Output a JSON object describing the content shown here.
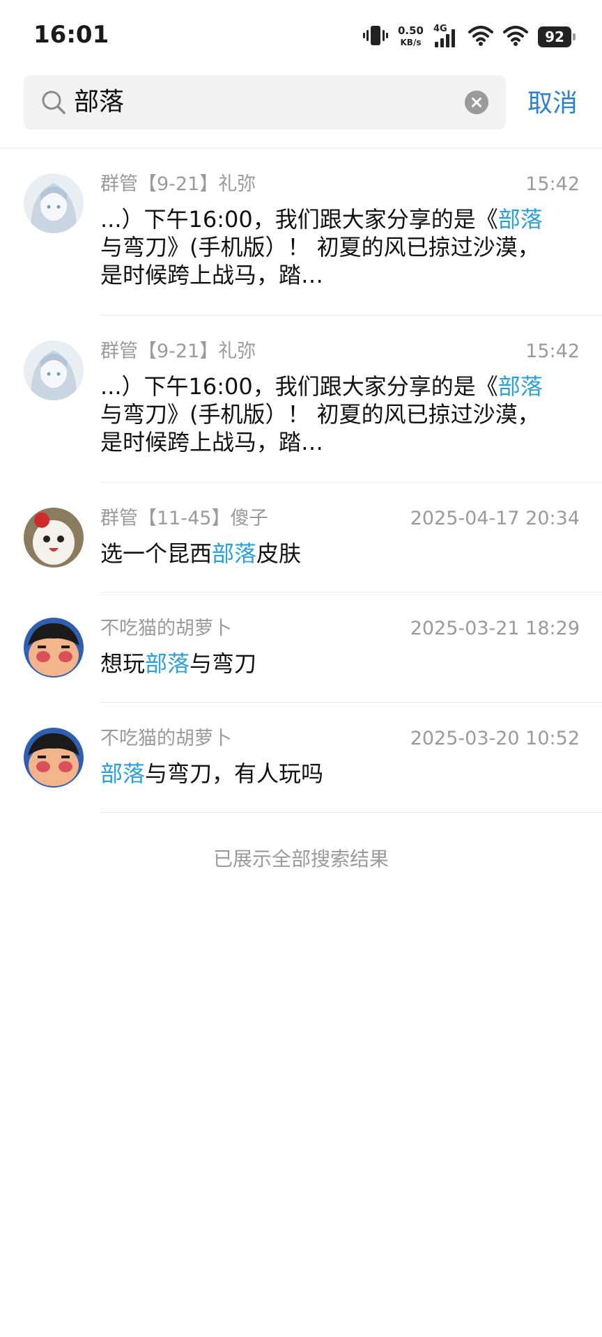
{
  "status_bar": {
    "time": "16:01",
    "net_speed": "0.50",
    "net_unit": "KB/s",
    "network_type": "4G",
    "battery": "92",
    "icons": [
      "vibrate-icon",
      "signal-icon",
      "wifi-icon",
      "wifi-icon",
      "battery-icon"
    ]
  },
  "search": {
    "query": "部落",
    "cancel_label": "取消"
  },
  "results": [
    {
      "sender": "群管【9-21】礼弥",
      "time": "15:42",
      "lines": [
        [
          {
            "t": "...）下午16:00，我们跟大家分享的是《"
          },
          {
            "t": "部落",
            "hl": true
          }
        ],
        [
          {
            "t": "与弯刀》(手机版）！ 初夏的风已掠过沙漠，"
          }
        ],
        [
          {
            "t": "是时候跨上战马，踏…"
          }
        ]
      ]
    },
    {
      "sender": "群管【9-21】礼弥",
      "time": "15:42",
      "lines": [
        [
          {
            "t": "...）下午16:00，我们跟大家分享的是《"
          },
          {
            "t": "部落",
            "hl": true
          }
        ],
        [
          {
            "t": "与弯刀》(手机版）！ 初夏的风已掠过沙漠，"
          }
        ],
        [
          {
            "t": "是时候跨上战马，踏…"
          }
        ]
      ]
    },
    {
      "sender": "群管【11-45】傻子",
      "time": "2025-04-17 20:34",
      "lines": [
        [
          {
            "t": "选一个昆西"
          },
          {
            "t": "部落",
            "hl": true
          },
          {
            "t": "皮肤"
          }
        ]
      ]
    },
    {
      "sender": "不吃猫的胡萝卜",
      "time": "2025-03-21 18:29",
      "lines": [
        [
          {
            "t": "想玩"
          },
          {
            "t": "部落",
            "hl": true
          },
          {
            "t": "与弯刀"
          }
        ]
      ]
    },
    {
      "sender": "不吃猫的胡萝卜",
      "time": "2025-03-20 10:52",
      "lines": [
        [
          {
            "t": "部落",
            "hl": true
          },
          {
            "t": "与弯刀，有人玩吗"
          }
        ]
      ]
    }
  ],
  "footer": "已展示全部搜索结果",
  "colors": {
    "highlight": "#2a9fd8",
    "cancel": "#2f7fd0",
    "meta": "#9a9a9a",
    "search_bg": "#f2f2f2"
  }
}
